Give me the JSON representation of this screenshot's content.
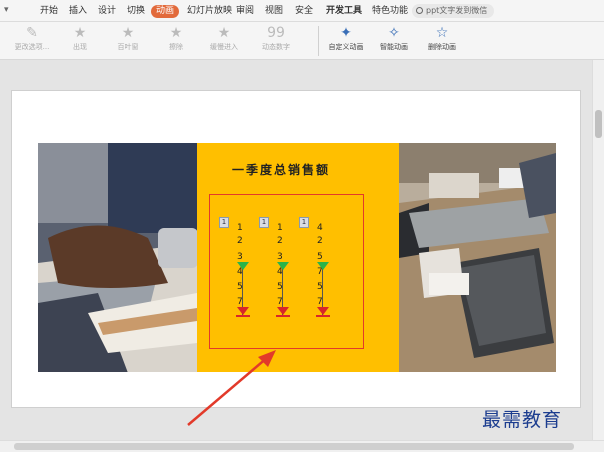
{
  "menu": {
    "items": [
      "开始",
      "插入",
      "设计",
      "切换",
      "动画",
      "幻灯片放映",
      "审阅",
      "视图",
      "安全",
      "开发工具",
      "特色功能"
    ],
    "active_index": 4,
    "search_placeholder": "ppt文字发到微信"
  },
  "ribbon": {
    "buttons": [
      "更改选项...",
      "出现",
      "百叶窗",
      "擦除",
      "缓慢进入",
      "动态数字",
      "自定义动画",
      "智能动画",
      "删除动画"
    ]
  },
  "slide": {
    "title": "一季度总销售额",
    "columns": [
      {
        "badge": "1",
        "values": [
          "1",
          "2",
          "3",
          "4",
          "5",
          "7"
        ]
      },
      {
        "badge": "1",
        "values": [
          "1",
          "2",
          "3",
          "4",
          "5",
          "7"
        ]
      },
      {
        "badge": "1",
        "values": [
          "4",
          "2",
          "5",
          "7",
          "5",
          "7"
        ]
      }
    ]
  },
  "watermark": "最需教育",
  "colors": {
    "accent": "#e26a3b",
    "panel": "#ffbf00",
    "frame": "#e23a2a",
    "arrow": "#e23a2a"
  }
}
